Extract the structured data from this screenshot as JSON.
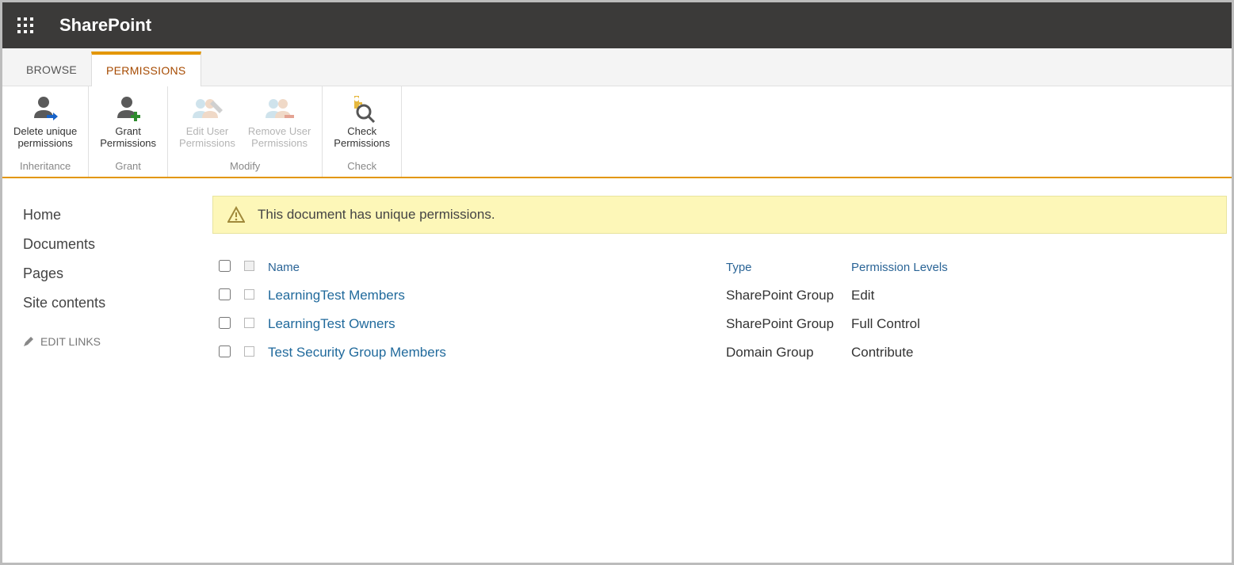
{
  "suite": {
    "app_title": "SharePoint"
  },
  "tabs": [
    {
      "label": "BROWSE",
      "active": false
    },
    {
      "label": "PERMISSIONS",
      "active": true
    }
  ],
  "ribbon": {
    "groups": [
      {
        "label": "Inheritance",
        "buttons": [
          {
            "key": "delete-unique",
            "label": "Delete unique\npermissions",
            "disabled": false
          }
        ]
      },
      {
        "label": "Grant",
        "buttons": [
          {
            "key": "grant",
            "label": "Grant\nPermissions",
            "disabled": false
          }
        ]
      },
      {
        "label": "Modify",
        "buttons": [
          {
            "key": "edit-user",
            "label": "Edit User\nPermissions",
            "disabled": true
          },
          {
            "key": "remove-user",
            "label": "Remove User\nPermissions",
            "disabled": true
          }
        ]
      },
      {
        "label": "Check",
        "buttons": [
          {
            "key": "check",
            "label": "Check\nPermissions",
            "disabled": false
          }
        ]
      }
    ]
  },
  "left_nav": {
    "items": [
      {
        "label": "Home"
      },
      {
        "label": "Documents"
      },
      {
        "label": "Pages"
      },
      {
        "label": "Site contents"
      }
    ],
    "edit_links_label": "EDIT LINKS"
  },
  "notice": {
    "text": "This document has unique permissions."
  },
  "table": {
    "headers": {
      "name": "Name",
      "type": "Type",
      "levels": "Permission Levels"
    },
    "rows": [
      {
        "name": "LearningTest Members",
        "type": "SharePoint Group",
        "level": "Edit"
      },
      {
        "name": "LearningTest Owners",
        "type": "SharePoint Group",
        "level": "Full Control"
      },
      {
        "name": "Test Security Group Members",
        "type": "Domain Group",
        "level": "Contribute"
      }
    ]
  }
}
